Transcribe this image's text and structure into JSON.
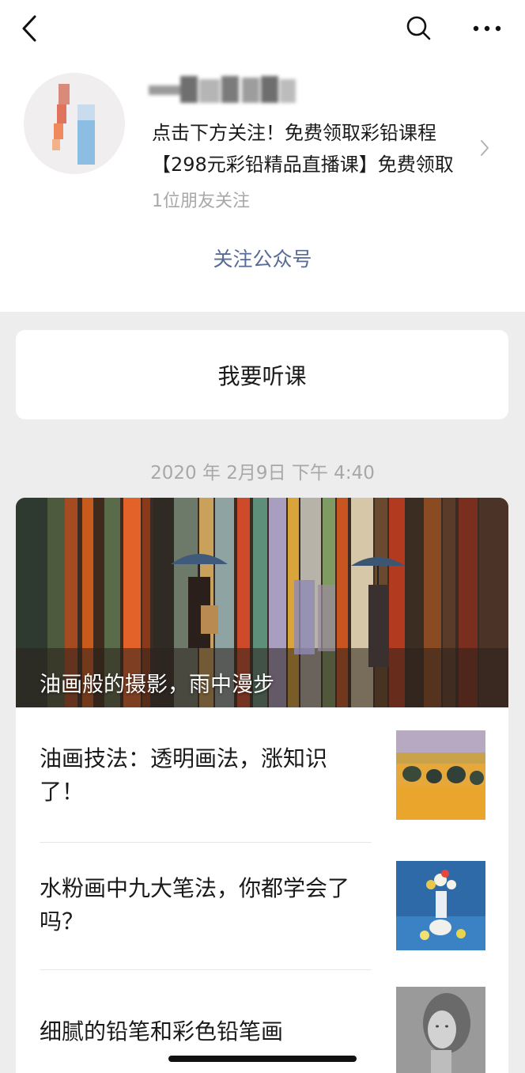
{
  "nav": {
    "back_icon": "chevron-left-icon",
    "search_icon": "search-icon",
    "more_icon": "more-dots-icon"
  },
  "profile": {
    "description_line1": "点击下方关注！免费领取彩铅课程",
    "description_line2": "【298元彩铅精品直播课】免费领取",
    "friends_following": "1位朋友关注",
    "follow_label": "关注公众号"
  },
  "menu": {
    "listen_label": "我要听课"
  },
  "feed": {
    "timestamp": "2020 年 2月9日 下午 4:40",
    "cover_title": "油画般的摄影，雨中漫步",
    "articles": [
      {
        "title": "油画技法：透明画法，涨知识了！"
      },
      {
        "title": "水粉画中九大笔法，你都学会了吗？"
      },
      {
        "title": "细腻的铅笔和彩色铅笔画"
      }
    ]
  },
  "colors": {
    "link": "#576b95",
    "background": "#ededed",
    "muted": "#a8a8a8"
  }
}
